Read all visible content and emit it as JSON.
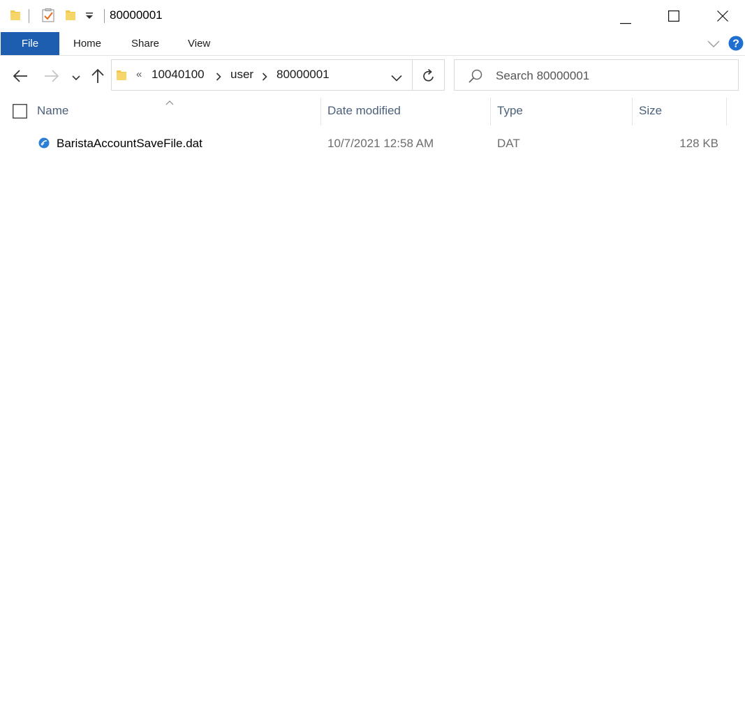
{
  "window": {
    "title": "80000001"
  },
  "ribbon": {
    "tabs": [
      {
        "label": "File"
      },
      {
        "label": "Home"
      },
      {
        "label": "Share"
      },
      {
        "label": "View"
      }
    ]
  },
  "address": {
    "overflow": "«",
    "crumbs": [
      "10040100",
      "user",
      "80000001"
    ]
  },
  "search": {
    "placeholder": "Search 80000001"
  },
  "columns": {
    "name": "Name",
    "date": "Date modified",
    "type": "Type",
    "size": "Size"
  },
  "files": [
    {
      "name": "BaristaAccountSaveFile.dat",
      "date": "10/7/2021 12:58 AM",
      "type": "DAT",
      "size": "128 KB"
    }
  ],
  "colors": {
    "accent": "#1e5eb1",
    "folder": "#f2c94c",
    "help": "#1e6fd0",
    "header_text": "#4c607a"
  },
  "icons": {
    "quick_access": [
      "folder-icon",
      "properties-icon",
      "new-folder-icon",
      "customize-dropdown-icon"
    ],
    "window_controls": [
      "minimize-icon",
      "maximize-icon",
      "close-icon"
    ],
    "nav": [
      "back-arrow-icon",
      "forward-arrow-icon",
      "recent-locations-icon",
      "up-arrow-icon"
    ],
    "file": "dat-file-icon"
  }
}
